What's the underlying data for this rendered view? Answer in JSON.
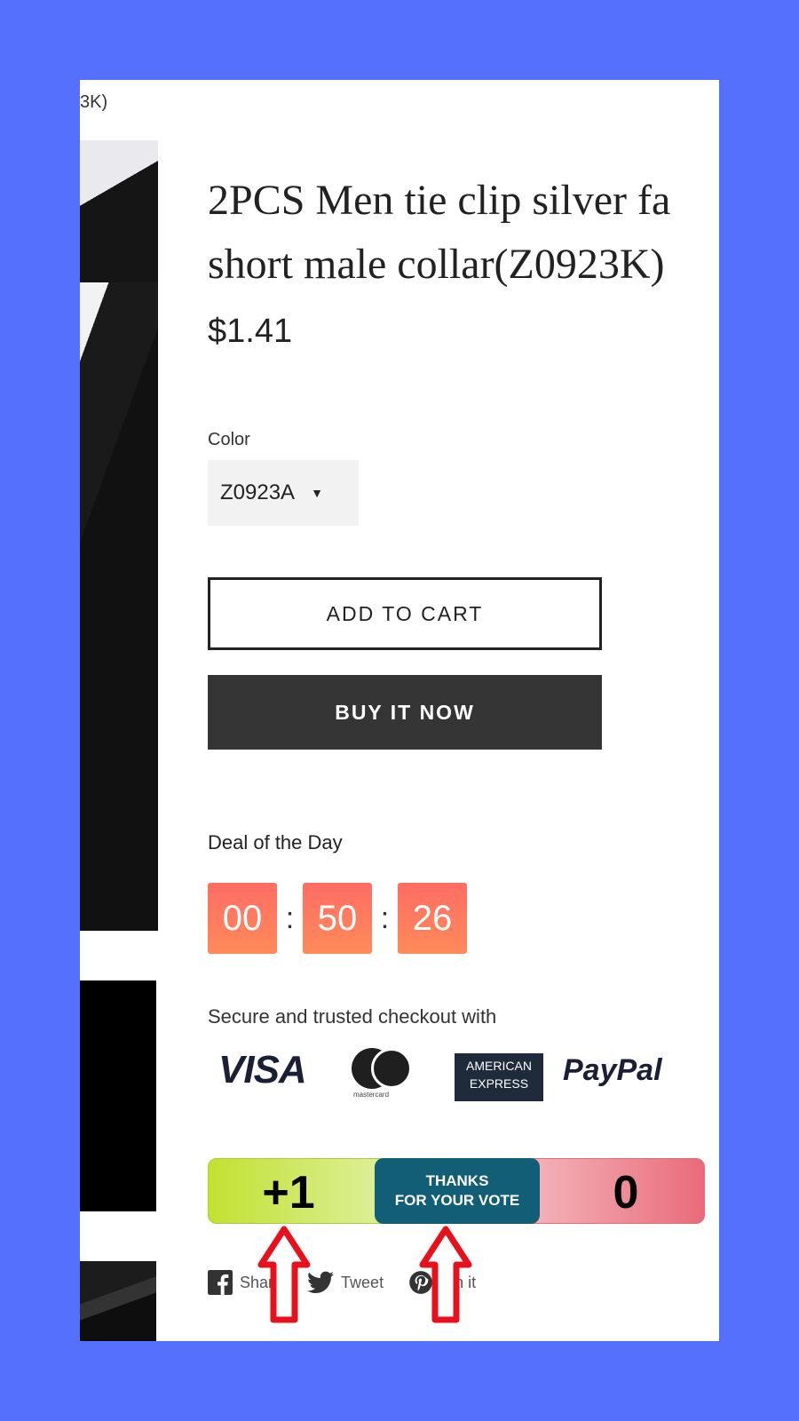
{
  "breadcrumb": "3K)",
  "product": {
    "title_line1": "2PCS Men tie clip silver fa",
    "title_line2": "short male collar(Z0923K)",
    "price": "$1.41"
  },
  "variant": {
    "label": "Color",
    "selected": "Z0923A"
  },
  "buttons": {
    "add_to_cart": "ADD TO CART",
    "buy_now": "BUY IT NOW"
  },
  "deal": {
    "label": "Deal of the Day",
    "hours": "00",
    "minutes": "50",
    "seconds": "26",
    "separator": ":"
  },
  "checkout": {
    "label": "Secure and trusted checkout with",
    "visa": "VISA",
    "mastercard_sub": "mastercard",
    "amex_line1": "AMERICAN",
    "amex_line2": "EXPRESS",
    "paypal": "PayPal"
  },
  "vote": {
    "up_count": "+1",
    "thanks_line1": "THANKS",
    "thanks_line2": "FOR YOUR VOTE",
    "down_count": "0"
  },
  "share": {
    "facebook": "Share",
    "twitter": "Tweet",
    "pinterest": "Pin it"
  },
  "colors": {
    "background": "#5470fd",
    "timer": "#ff7a5e",
    "vote_up": "#c2e131",
    "vote_down": "#ea6b79",
    "vote_thanks": "#135e77",
    "arrow": "#e8101a"
  },
  "icons": [
    "facebook-icon",
    "twitter-icon",
    "pinterest-icon",
    "arrow-up-icon",
    "chevron-down-icon"
  ]
}
